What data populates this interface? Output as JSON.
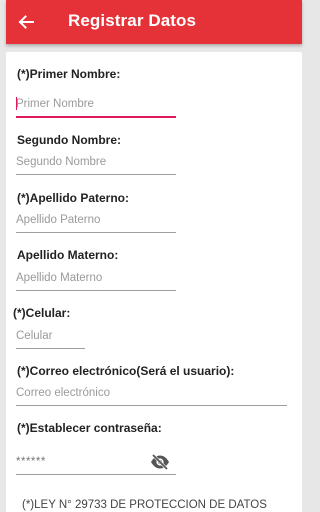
{
  "appbar": {
    "title": "Registrar Datos",
    "back_icon": "arrow-back-icon",
    "color": "#e53238"
  },
  "form": {
    "primer_nombre": {
      "label": "(*)Primer Nombre:",
      "placeholder": "Primer Nombre"
    },
    "segundo_nombre": {
      "label": "Segundo Nombre:",
      "placeholder": "Segundo Nombre"
    },
    "apellido_paterno": {
      "label": "(*)Apellido Paterno:",
      "placeholder": "Apellido Paterno"
    },
    "apellido_materno": {
      "label": "Apellido Materno:",
      "placeholder": "Apellido Materno"
    },
    "celular": {
      "label": "(*)Celular:",
      "placeholder": "Celular"
    },
    "correo": {
      "label": "(*)Correo electrónico(Será el usuario):",
      "placeholder": "Correo electrónico"
    },
    "contrasena": {
      "label": "(*)Establecer contraseña:",
      "value": "******",
      "toggle_icon": "visibility-off-icon"
    },
    "law_text": "(*)LEY N° 29733 DE PROTECCION DE DATOS"
  },
  "accent_color": "#e0195a"
}
